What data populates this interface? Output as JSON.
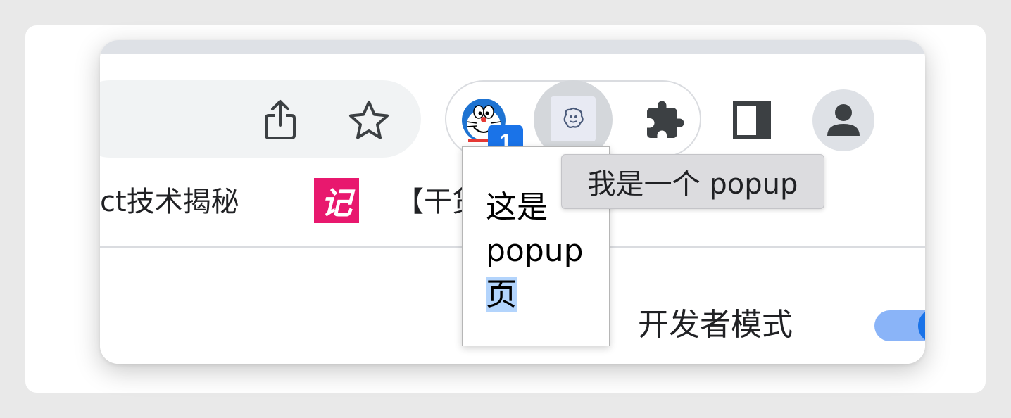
{
  "toolbar": {
    "icons": [
      "share-icon",
      "bookmark-star-icon",
      "doraemon-extension-icon",
      "popup-extension-icon",
      "extensions-puzzle-icon",
      "side-panel-icon",
      "profile-avatar-icon"
    ],
    "extension_badge": "1",
    "accent_color": "#1a73e8"
  },
  "bookmarks": {
    "items": [
      {
        "label": "ct技术揭秘"
      },
      {
        "logo_text": "记",
        "color": "#e8186e"
      },
      {
        "label": "【干货"
      }
    ]
  },
  "content": {
    "developer_mode_label": "开发者模式",
    "developer_mode_enabled": true
  },
  "popup": {
    "line1": "这是",
    "line2": "popup",
    "line3": "页"
  },
  "tooltip": {
    "text": "我是一个 popup"
  }
}
